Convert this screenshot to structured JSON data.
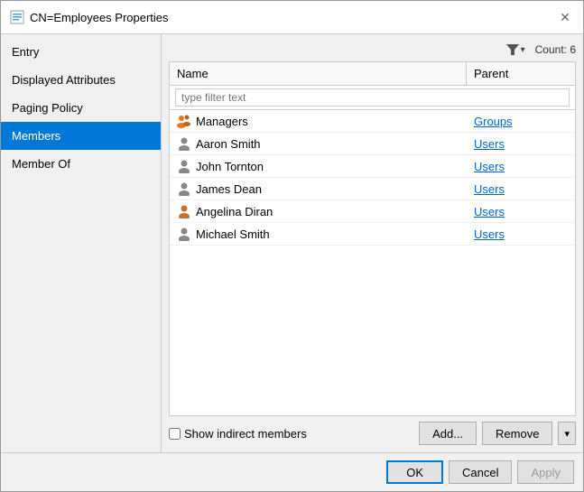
{
  "dialog": {
    "title": "CN=Employees Properties",
    "icon": "properties-icon"
  },
  "sidebar": {
    "items": [
      {
        "id": "entry",
        "label": "Entry",
        "active": false
      },
      {
        "id": "displayed-attributes",
        "label": "Displayed Attributes",
        "active": false
      },
      {
        "id": "paging-policy",
        "label": "Paging Policy",
        "active": false
      },
      {
        "id": "members",
        "label": "Members",
        "active": true
      },
      {
        "id": "member-of",
        "label": "Member Of",
        "active": false
      }
    ]
  },
  "main": {
    "toolbar": {
      "filter_icon": "▼",
      "count_label": "Count: 6"
    },
    "table": {
      "columns": [
        "Name",
        "Parent"
      ],
      "filter_placeholder": "type filter text",
      "rows": [
        {
          "name": "Managers",
          "parent": "Groups",
          "icon_type": "group"
        },
        {
          "name": "Aaron Smith",
          "parent": "Users",
          "icon_type": "user"
        },
        {
          "name": "John Tornton",
          "parent": "Users",
          "icon_type": "user"
        },
        {
          "name": "James Dean",
          "parent": "Users",
          "icon_type": "user"
        },
        {
          "name": "Angelina Diran",
          "parent": "Users",
          "icon_type": "user"
        },
        {
          "name": "Michael Smith",
          "parent": "Users",
          "icon_type": "user"
        }
      ]
    },
    "bottom": {
      "checkbox_label": "Show indirect members",
      "add_button": "Add...",
      "remove_button": "Remove",
      "dropdown_arrow": "▾"
    }
  },
  "footer": {
    "ok_button": "OK",
    "cancel_button": "Cancel",
    "apply_button": "Apply"
  }
}
